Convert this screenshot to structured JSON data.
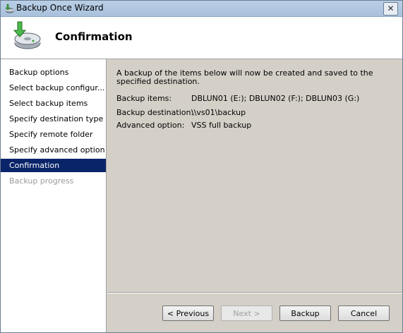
{
  "window": {
    "title": "Backup Once Wizard",
    "close_glyph": "✕"
  },
  "header": {
    "title": "Confirmation",
    "icon": "backup-disk-icon"
  },
  "steps": [
    {
      "label": "Backup options",
      "state": "normal"
    },
    {
      "label": "Select backup configur...",
      "state": "normal"
    },
    {
      "label": "Select backup items",
      "state": "normal"
    },
    {
      "label": "Specify destination type",
      "state": "normal"
    },
    {
      "label": "Specify remote folder",
      "state": "normal"
    },
    {
      "label": "Specify advanced option",
      "state": "normal"
    },
    {
      "label": "Confirmation",
      "state": "active"
    },
    {
      "label": "Backup progress",
      "state": "disabled"
    }
  ],
  "content": {
    "intro": "A backup of the items below will now be created and saved to the specified destination.",
    "details": [
      {
        "label": "Backup items:",
        "value": "DBLUN01 (E:); DBLUN02 (F:); DBLUN03 (G:)"
      },
      {
        "label": "Backup destination:",
        "value": "\\\\vs01\\backup"
      },
      {
        "label": "Advanced option:",
        "value": "VSS full backup"
      }
    ]
  },
  "buttons": {
    "previous": "< Previous",
    "next": "Next >",
    "backup": "Backup",
    "cancel": "Cancel"
  },
  "colors": {
    "active_step_bg": "#0a246a",
    "disabled_text": "#9a9a9a"
  }
}
